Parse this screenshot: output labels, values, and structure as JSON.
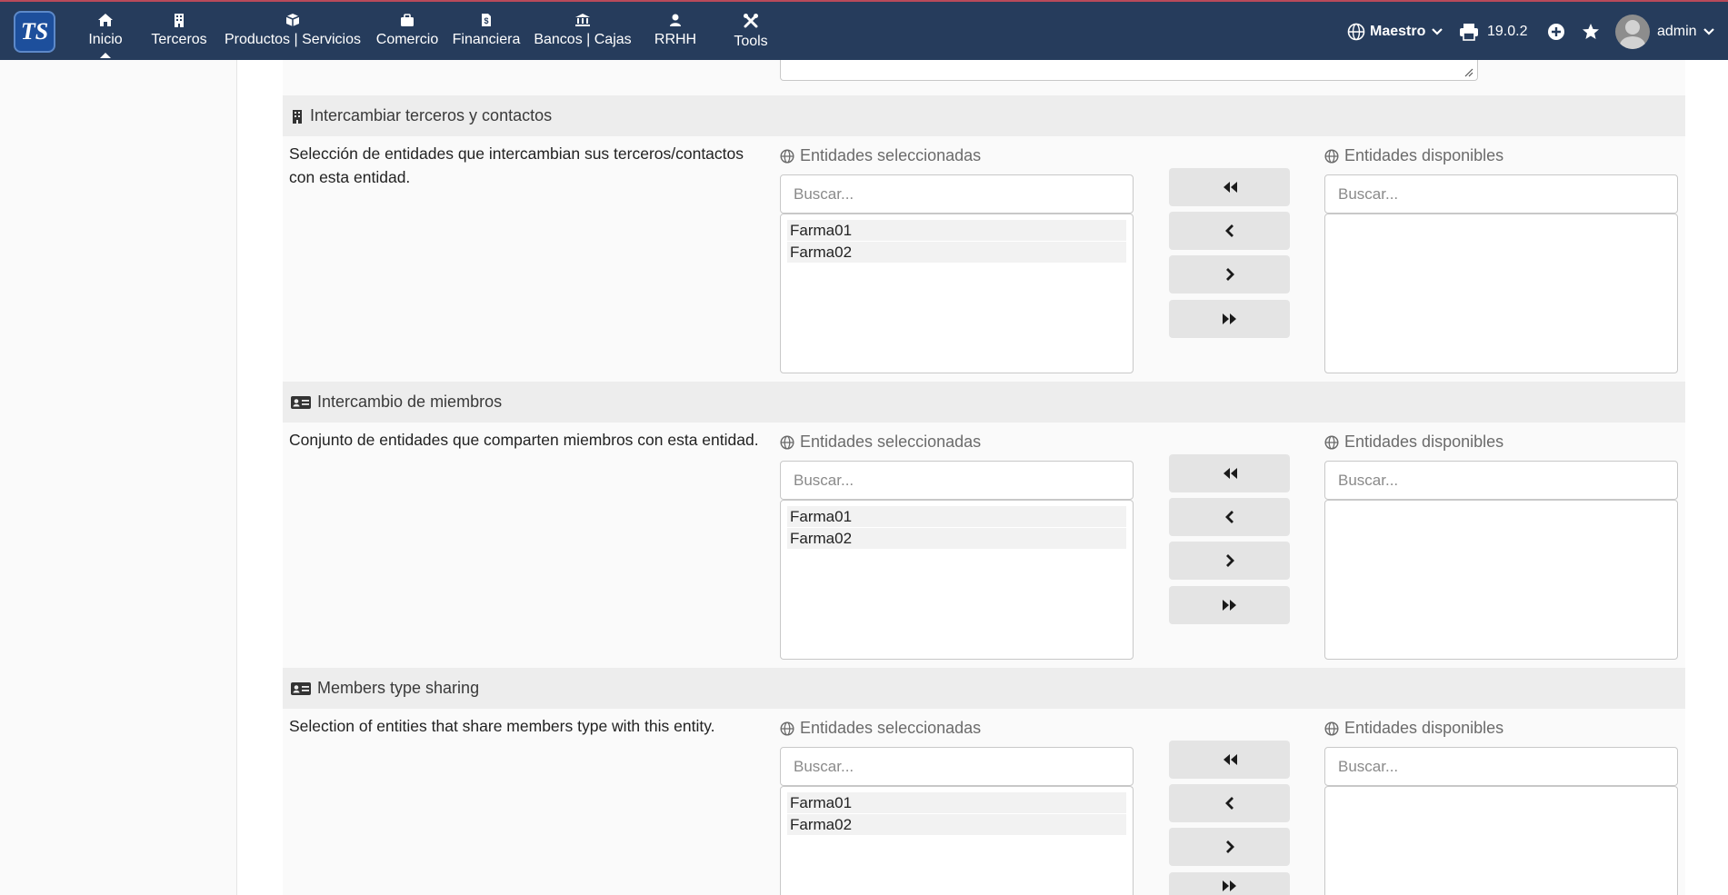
{
  "app": {
    "logo_text": "TS",
    "brand_color": "#263c5c",
    "accent_color": "#b94a5a"
  },
  "nav": {
    "items": [
      {
        "label": "Inicio",
        "icon": "home-icon",
        "active": true
      },
      {
        "label": "Terceros",
        "icon": "building-icon"
      },
      {
        "label": "Productos | Servicios",
        "icon": "cube-icon"
      },
      {
        "label": "Comercio",
        "icon": "briefcase-icon"
      },
      {
        "label": "Financiera",
        "icon": "invoice-icon"
      },
      {
        "label": "Bancos | Cajas",
        "icon": "bank-icon"
      },
      {
        "label": "RRHH",
        "icon": "user-icon"
      },
      {
        "label": "Tools",
        "icon": "tools-icon"
      }
    ],
    "entity": "Maestro",
    "version": "19.0.2",
    "user": "admin"
  },
  "sections": [
    {
      "title": "Intercambiar terceros y contactos",
      "icon": "building-icon",
      "description": "Selección de entidades que intercambian sus terceros/contactos con esta entidad.",
      "selected_title": "Entidades seleccionadas",
      "available_title": "Entidades disponibles",
      "search_placeholder": "Buscar...",
      "selected_items": [
        "Farma01",
        "Farma02"
      ],
      "available_items": []
    },
    {
      "title": "Intercambio de miembros",
      "icon": "id-card-icon",
      "description": "Conjunto de entidades que comparten miembros con esta entidad.",
      "selected_title": "Entidades seleccionadas",
      "available_title": "Entidades disponibles",
      "search_placeholder": "Buscar...",
      "selected_items": [
        "Farma01",
        "Farma02"
      ],
      "available_items": []
    },
    {
      "title": "Members type sharing",
      "icon": "id-card-icon",
      "description": "Selection of entities that share members type with this entity.",
      "selected_title": "Entidades seleccionadas",
      "available_title": "Entidades disponibles",
      "search_placeholder": "Buscar...",
      "selected_items": [
        "Farma01",
        "Farma02"
      ],
      "available_items": []
    }
  ]
}
